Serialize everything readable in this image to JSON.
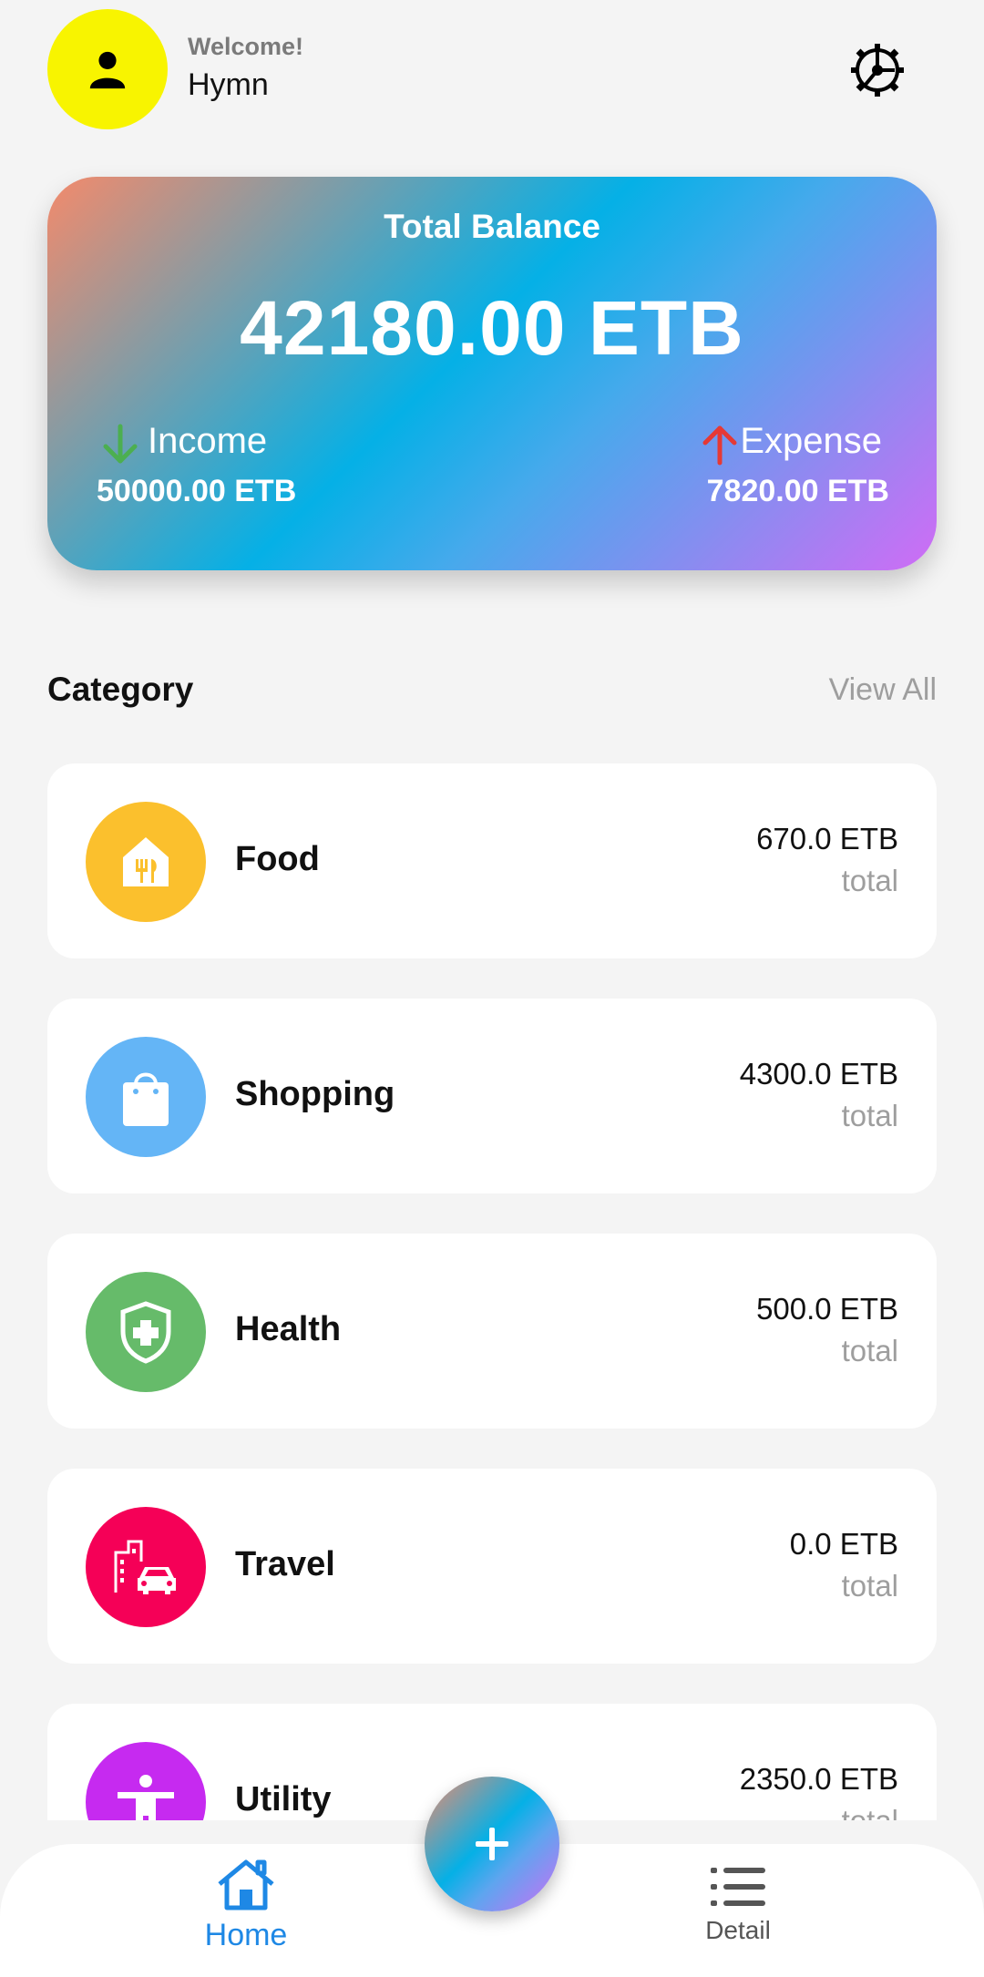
{
  "header": {
    "welcome": "Welcome!",
    "username": "Hymn",
    "avatar_icon": "person-icon",
    "settings_icon": "gear-icon"
  },
  "balance": {
    "title": "Total Balance",
    "amount": "42180.00 ETB",
    "income_label": "Income",
    "income_value": "50000.00 ETB",
    "expense_label": "Expense",
    "expense_value": "7820.00 ETB",
    "income_arrow_color": "#4caf50",
    "expense_arrow_color": "#e53935"
  },
  "category": {
    "title": "Category",
    "view_all": "View All",
    "items": [
      {
        "name": "Food",
        "amount": "670.0 ETB",
        "total": "total",
        "color": "#fbc02d",
        "icon": "food-icon"
      },
      {
        "name": "Shopping",
        "amount": "4300.0 ETB",
        "total": "total",
        "color": "#64b5f6",
        "icon": "shopping-bag-icon"
      },
      {
        "name": "Health",
        "amount": "500.0 ETB",
        "total": "total",
        "color": "#66bb6a",
        "icon": "health-shield-icon"
      },
      {
        "name": "Travel",
        "amount": "0.0 ETB",
        "total": "total",
        "color": "#f50057",
        "icon": "travel-icon"
      },
      {
        "name": "Utility",
        "amount": "2350.0 ETB",
        "total": "total",
        "color": "#c62af0",
        "icon": "utility-person-icon"
      }
    ]
  },
  "nav": {
    "home_label": "Home",
    "detail_label": "Detail",
    "accent": "#1e88e5"
  }
}
